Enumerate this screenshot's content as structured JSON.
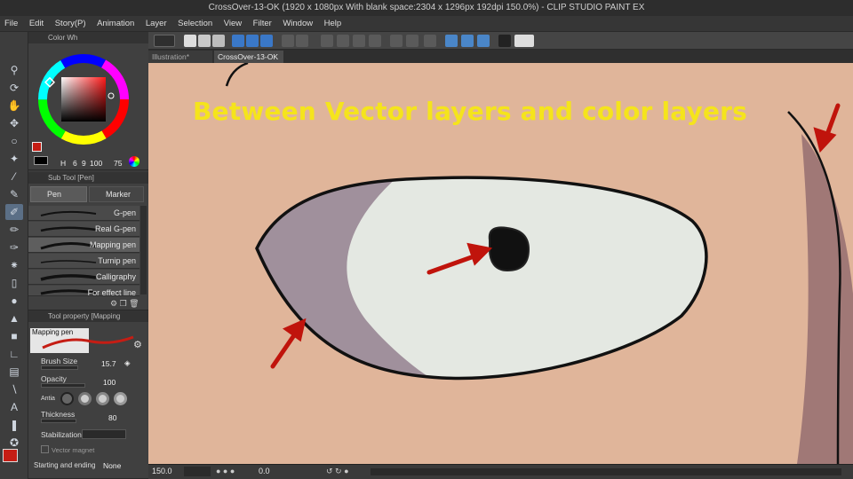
{
  "window": {
    "title": "CrossOver-13-OK (1920 x 1080px With blank space:2304 x 1296px 192dpi 150.0%) - CLIP STUDIO PAINT EX"
  },
  "menu": [
    "File",
    "Edit",
    "Story(P)",
    "Animation",
    "Layer",
    "Selection",
    "View",
    "Filter",
    "Window",
    "Help"
  ],
  "tabs": [
    {
      "label": "Illustration*"
    },
    {
      "label": "CrossOver-13-OK"
    }
  ],
  "color_panel": {
    "title": "Color Wh",
    "h": "6",
    "s": "9",
    "v": "100",
    "v2": "75"
  },
  "subtool_panel": {
    "title": "Sub Tool [Pen]",
    "tab_pen": "Pen",
    "tab_marker": "Marker",
    "brushes": [
      "G-pen",
      "Real G-pen",
      "Mapping pen",
      "Turnip pen",
      "Calligraphy",
      "For effect line"
    ]
  },
  "property_panel": {
    "title": "Tool property [Mapping",
    "preview_label": "Mapping pen",
    "brush_size_label": "Brush Size",
    "brush_size": "15.7",
    "opacity_label": "Opacity",
    "opacity": "100",
    "anti_label": "Antia",
    "thickness_label": "Thickness",
    "thickness": "80",
    "stabilization_label": "Stabilization",
    "vector_label": "Vector magnet",
    "start_end_label": "Starting and ending",
    "start_end_value": "None"
  },
  "canvas": {
    "caption": "Between Vector layers and color layers"
  },
  "status": {
    "zoom": "150.0",
    "angle": "0.0"
  },
  "colors": {
    "main": "#c51d14",
    "sub": "#000000",
    "skin": "#e0b59a",
    "eye_white": "#e4e8e2",
    "shadow": "#a0909c",
    "arrow": "#c0140c",
    "caption": "#f5e41c"
  }
}
